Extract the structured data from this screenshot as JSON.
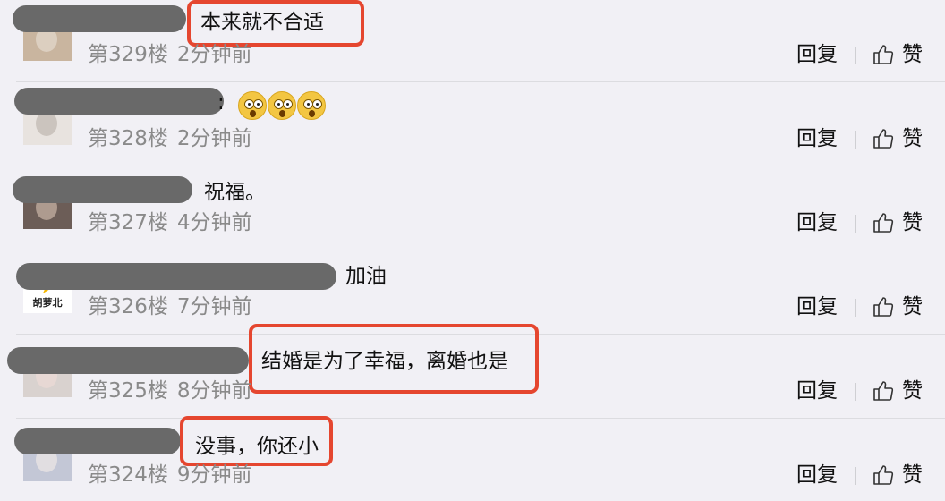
{
  "comments": [
    {
      "floor_label": "第329楼",
      "time_ago": "2分钟前",
      "text": "本来就不合适",
      "reply_label": "回复",
      "like_label": "赞",
      "has_emoji": false,
      "highlighted": true
    },
    {
      "floor_label": "第328楼",
      "time_ago": "2分钟前",
      "text": "",
      "reply_label": "回复",
      "like_label": "赞",
      "has_emoji": true,
      "emoji_count": 3,
      "highlighted": false
    },
    {
      "floor_label": "第327楼",
      "time_ago": "4分钟前",
      "text": "祝福。",
      "reply_label": "回复",
      "like_label": "赞",
      "has_emoji": false,
      "highlighted": false
    },
    {
      "floor_label": "第326楼",
      "time_ago": "7分钟前",
      "text": "加油",
      "avatar_text": "胡萝北",
      "reply_label": "回复",
      "like_label": "赞",
      "has_emoji": false,
      "highlighted": false
    },
    {
      "floor_label": "第325楼",
      "time_ago": "8分钟前",
      "text": "结婚是为了幸福，离婚也是",
      "reply_label": "回复",
      "like_label": "赞",
      "has_emoji": false,
      "highlighted": true
    },
    {
      "floor_label": "第324楼",
      "time_ago": "9分钟前",
      "text": "没事，你还小",
      "reply_label": "回复",
      "like_label": "赞",
      "has_emoji": false,
      "highlighted": true
    }
  ],
  "colors": {
    "background": "#f1f0f5",
    "highlight": "#e5462f",
    "meta_text": "#8a8a8a",
    "name_redaction": "#696969"
  },
  "icons": {
    "like": "thumbs-up-icon",
    "emoji": "astonished-face-icon"
  }
}
